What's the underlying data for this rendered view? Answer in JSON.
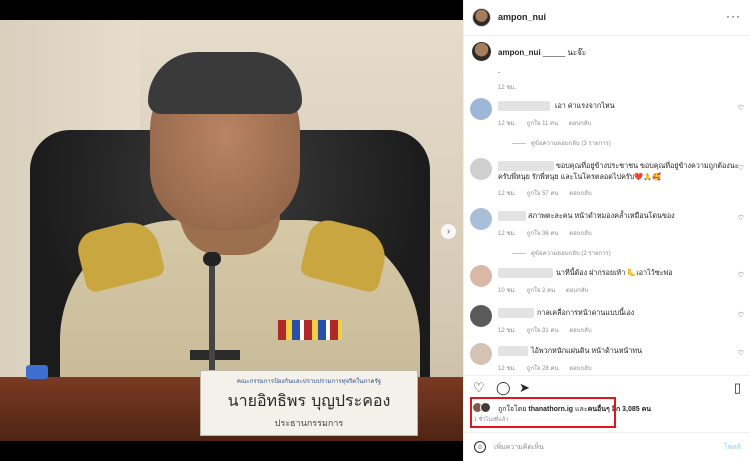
{
  "post": {
    "sign_small_text": "คณะกรรมการป้องกันและปราบปรามการทุจริตในภาครัฐ",
    "sign_name": "นายอิทธิพร บุญประคอง",
    "sign_title": "ประธานกรรมการ",
    "name_tag": "อิทธิพร บุญประคอง",
    "next_icon": "chevron-right-icon"
  },
  "header": {
    "username": "ampon_nui",
    "more_icon": "more-dots-icon"
  },
  "caption": {
    "username": "ampon_nui",
    "text": "_____ นะจ๊ะ",
    "dot": ".",
    "time": "12 ชม."
  },
  "comments": [
    {
      "text": "เอา ค่าแรงจากไหน",
      "time": "12 ชม.",
      "likes": "ถูกใจ 11 คน",
      "reply": "ตอบกลับ",
      "replies": "ดูข้อความตอบกลับ (3 รายการ)",
      "avatar_color": "#9fb7d6"
    },
    {
      "text": "ขอบคุณที่อยู่ข้างประชาชน ขอบคุณที่อยู่ข้างความถูกต้องนะ",
      "text2": "ครับพี่หนุย รักพี่หนุย และโนโครตลอดไปครับ❤️🙏🥰",
      "time": "12 ชม.",
      "likes": "ถูกใจ 57 คน",
      "reply": "ตอบกลับ",
      "avatar_color": "#cfcfcf"
    },
    {
      "text": "สภาพตะละคน หน้าดำหมองคล้ำเหมือนโดนของ",
      "time": "12 ชม.",
      "likes": "ถูกใจ 36 คน",
      "reply": "ตอบกลับ",
      "replies": "ดูข้อความตอบกลับ (2 รายการ)",
      "avatar_color": "#a9bfd8"
    },
    {
      "text": "นาทีนี้ต้อง ฝากรอยเท้า 🦶เอาไว้ซะพ่อ",
      "time": "10 ชม.",
      "likes": "ถูกใจ 2 คน",
      "reply": "ตอบกลับ",
      "avatar_color": "#d9b8a8"
    },
    {
      "text": "กาลเคลื่อการหน้าดานแบบนี้เอง",
      "time": "12 ชม.",
      "likes": "ถูกใจ 31 คน",
      "reply": "ตอบกลับ",
      "avatar_color": "#5a5a5a"
    },
    {
      "text": "ไอ้พวกหนักแผ่นดิน หน้าด้านหน้าทน",
      "time": "12 ชม.",
      "likes": "ถูกใจ 28 คน",
      "reply": "ตอบกลับ",
      "avatar_color": "#d4c2b4"
    }
  ],
  "actions": {
    "like_icon": "heart-icon",
    "comment_icon": "comment-icon",
    "share_icon": "send-icon",
    "save_icon": "bookmark-icon"
  },
  "likes": {
    "prefix": "ถูกใจโดย",
    "user": "thanathorn.ig",
    "middle": "และ",
    "others": "คนอื่นๆ อีก 3,085 คน",
    "time": "1 ชั่วโมงที่แล้ว"
  },
  "add_comment": {
    "placeholder": "เพิ่มความคิดเห็น",
    "post_label": "โพสต์",
    "emoji_icon": "emoji-icon"
  },
  "colors": {
    "highlight": "#e0161b",
    "link_blue": "#0095f6"
  }
}
